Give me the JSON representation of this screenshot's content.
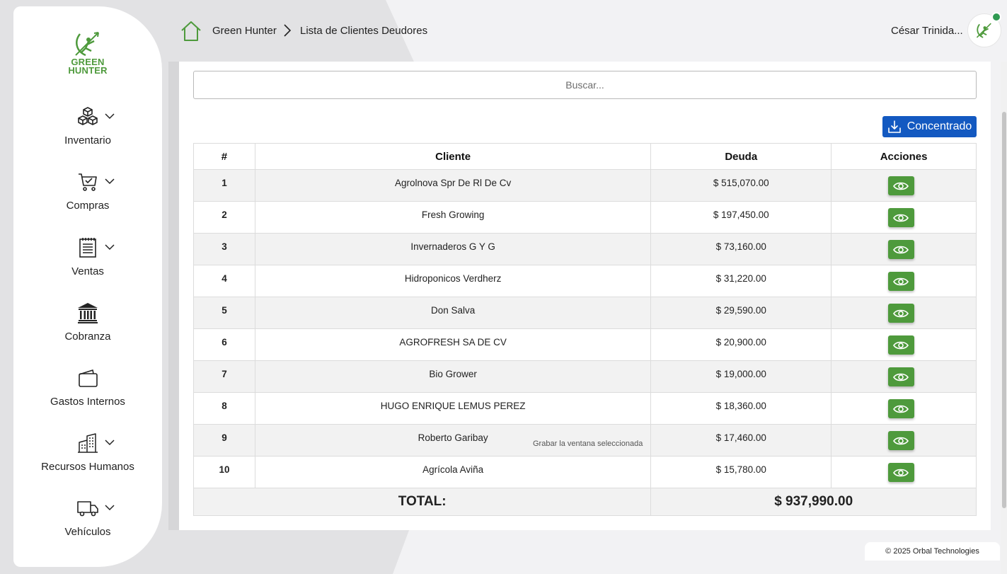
{
  "brand": {
    "line1": "GREEN",
    "line2": "HUNTER",
    "accent": "#4e9a3c"
  },
  "sidebar": {
    "items": [
      {
        "label": "Inventario",
        "icon": "cubes-icon",
        "expandable": true
      },
      {
        "label": "Compras",
        "icon": "cart-check-icon",
        "expandable": true
      },
      {
        "label": "Ventas",
        "icon": "ledger-icon",
        "expandable": true
      },
      {
        "label": "Cobranza",
        "icon": "bank-icon",
        "expandable": false
      },
      {
        "label": "Gastos Internos",
        "icon": "wallet-icon",
        "expandable": false
      },
      {
        "label": "Recursos Humanos",
        "icon": "buildings-icon",
        "expandable": true
      },
      {
        "label": "Vehículos",
        "icon": "truck-icon",
        "expandable": true
      }
    ]
  },
  "header": {
    "breadcrumb": {
      "root": "Green Hunter",
      "current": "Lista de Clientes Deudores"
    },
    "user_name": "César Trinida...",
    "status_color": "#2f9a52"
  },
  "search": {
    "placeholder": "Buscar...",
    "value": ""
  },
  "toolbar": {
    "export_label": "Concentrado",
    "export_color": "#1359c1"
  },
  "table": {
    "headers": {
      "num": "#",
      "client": "Cliente",
      "debt": "Deuda",
      "actions": "Acciones"
    },
    "rows": [
      {
        "num": "1",
        "client": "Agrolnova Spr De Rl De Cv",
        "debt": "$ 515,070.00"
      },
      {
        "num": "2",
        "client": "Fresh Growing",
        "debt": "$ 197,450.00"
      },
      {
        "num": "3",
        "client": "Invernaderos G Y G",
        "debt": "$ 73,160.00"
      },
      {
        "num": "4",
        "client": "Hidroponicos Verdherz",
        "debt": "$ 31,220.00"
      },
      {
        "num": "5",
        "client": "Don Salva",
        "debt": "$ 29,590.00"
      },
      {
        "num": "6",
        "client": "AGROFRESH SA DE CV",
        "debt": "$ 20,900.00"
      },
      {
        "num": "7",
        "client": "Bio Grower",
        "debt": "$ 19,000.00"
      },
      {
        "num": "8",
        "client": "HUGO ENRIQUE LEMUS PEREZ",
        "debt": "$ 18,360.00"
      },
      {
        "num": "9",
        "client": "Roberto Garibay",
        "debt": "$ 17,460.00"
      },
      {
        "num": "10",
        "client": "Agrícola Aviña",
        "debt": "$ 15,780.00"
      }
    ],
    "total_label": "TOTAL:",
    "total_value": "$ 937,990.00"
  },
  "tooltip": "Grabar la ventana seleccionada",
  "footer": "© 2025 Orbal Technologies"
}
